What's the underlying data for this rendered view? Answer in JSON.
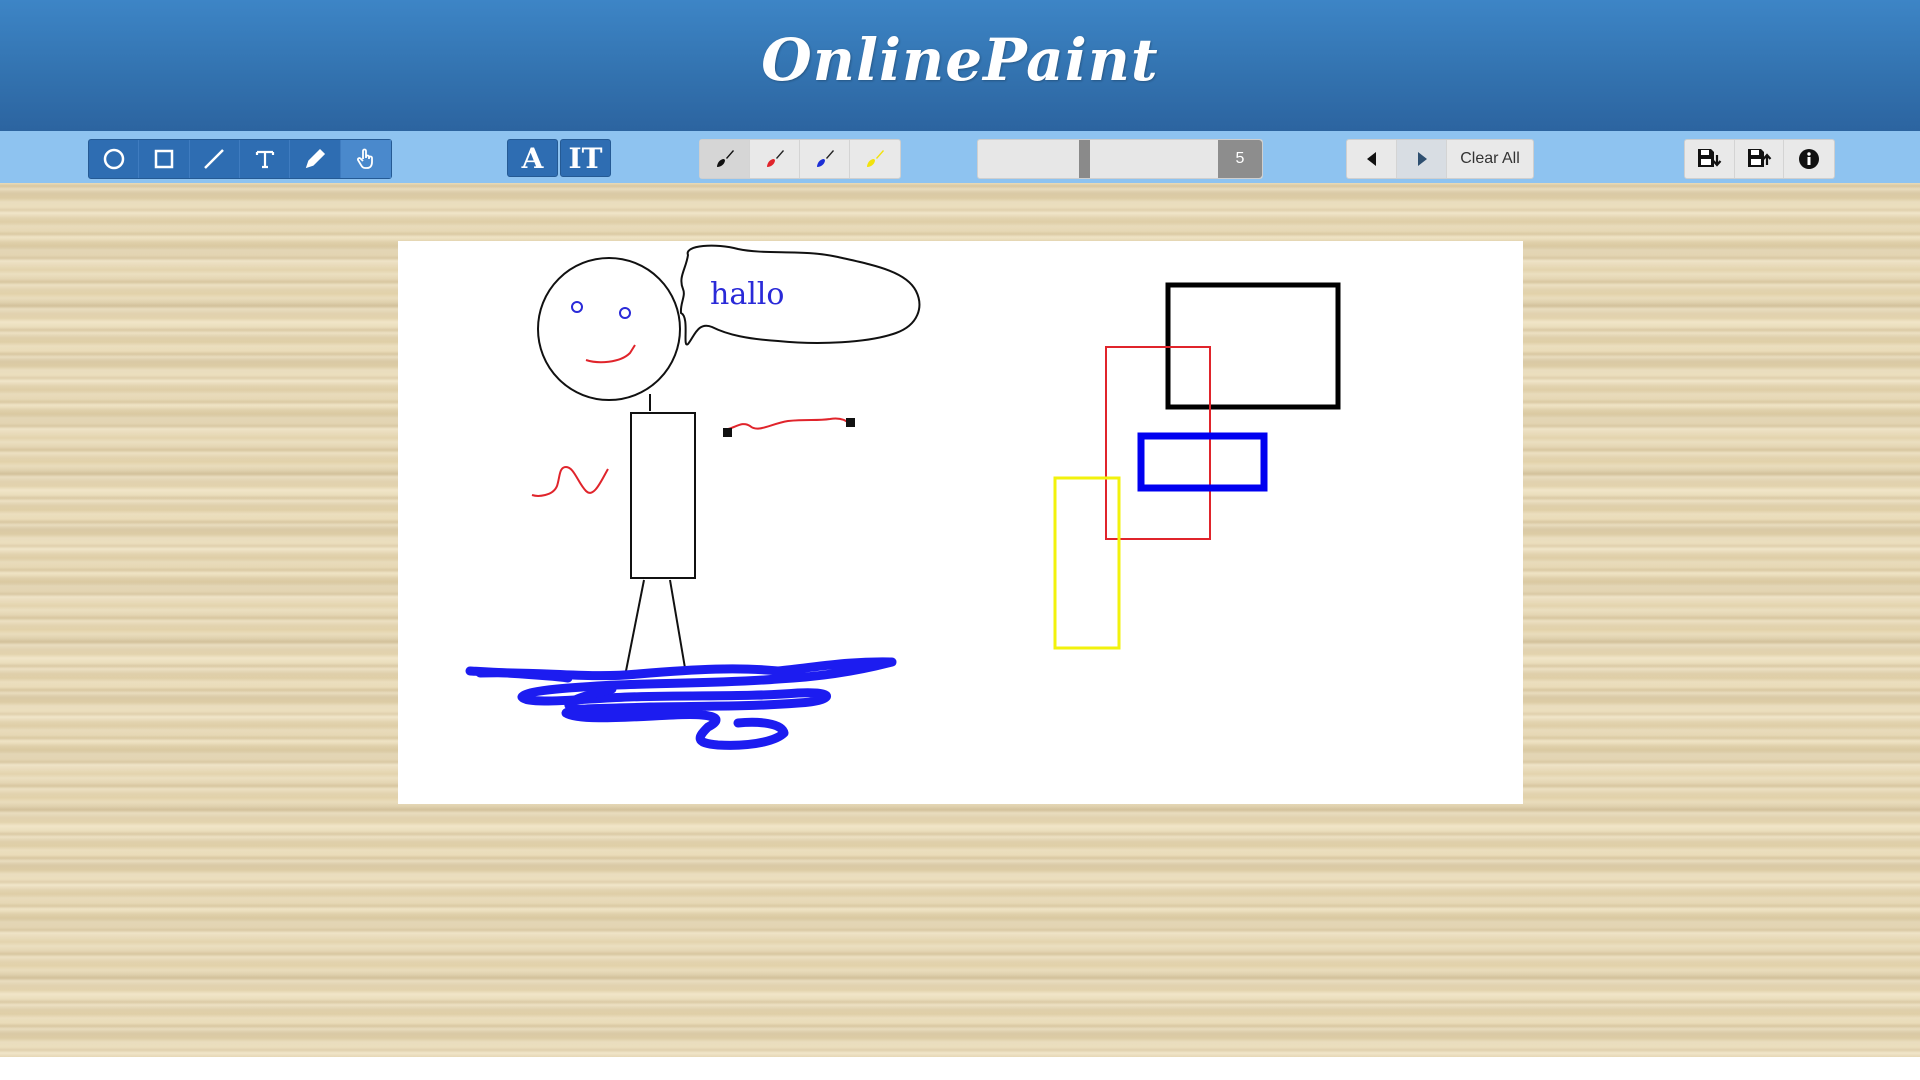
{
  "app": {
    "title": "OnlinePaint"
  },
  "toolbar": {
    "tools": [
      {
        "name": "circle-tool",
        "icon": "circle-icon"
      },
      {
        "name": "rectangle-tool",
        "icon": "square-icon"
      },
      {
        "name": "line-tool",
        "icon": "line-icon"
      },
      {
        "name": "text-tool",
        "icon": "text-icon"
      },
      {
        "name": "pencil-tool",
        "icon": "pencil-icon"
      },
      {
        "name": "hand-tool",
        "icon": "hand-icon"
      }
    ],
    "text_buttons": {
      "font_label": "A",
      "size_label": "IT"
    },
    "colors": [
      "#111111",
      "#e0242b",
      "#1c2fd6",
      "#f2e20c"
    ],
    "size": {
      "value": "5"
    },
    "clear_label": "Clear All"
  },
  "canvas": {
    "speech_text": "hallo"
  }
}
